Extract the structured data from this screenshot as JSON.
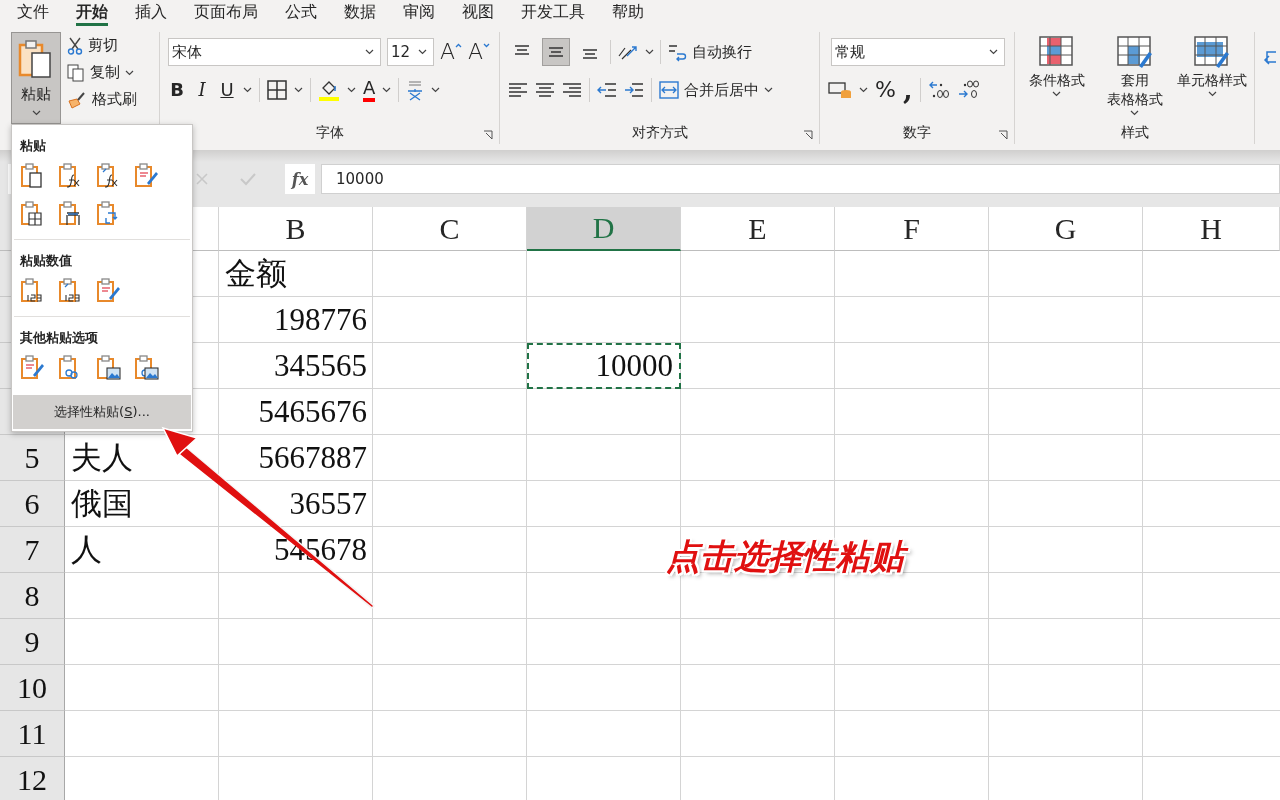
{
  "tabs": [
    {
      "label": "文件",
      "selected": false
    },
    {
      "label": "开始",
      "selected": true
    },
    {
      "label": "插入",
      "selected": false
    },
    {
      "label": "页面布局",
      "selected": false
    },
    {
      "label": "公式",
      "selected": false
    },
    {
      "label": "数据",
      "selected": false
    },
    {
      "label": "审阅",
      "selected": false
    },
    {
      "label": "视图",
      "selected": false
    },
    {
      "label": "开发工具",
      "selected": false
    },
    {
      "label": "帮助",
      "selected": false
    }
  ],
  "clipboard": {
    "paste": {
      "label": "粘贴",
      "pressed": true
    },
    "cut": "剪切",
    "copy": "复制",
    "format_painter": "格式刷"
  },
  "font": {
    "name": "宋体",
    "size": "12",
    "grow": "A",
    "shrink": "A",
    "bold": "B",
    "italic": "I",
    "underline": "U",
    "font_color": "A",
    "label": "字体"
  },
  "alignment": {
    "vertical": [
      {
        "selected": false
      },
      {
        "selected": true
      },
      {
        "selected": false
      }
    ],
    "wrap": "自动换行",
    "merge": "合并后居中",
    "label": "对齐方式"
  },
  "number": {
    "format": "常规",
    "percent": "%",
    "comma": ",",
    "label": "数字"
  },
  "styles": {
    "items": [
      {
        "lines": [
          "条件格式"
        ]
      },
      {
        "lines": [
          "套用",
          "表格格式"
        ]
      },
      {
        "lines": [
          "单元格样式"
        ]
      }
    ],
    "label": "样式"
  },
  "formula_bar": {
    "fx": "fx",
    "value": "10000"
  },
  "columns": [
    {
      "selected": false
    },
    {
      "label": "B",
      "selected": false
    },
    {
      "label": "C",
      "selected": false
    },
    {
      "label": "D",
      "selected": true
    },
    {
      "label": "E",
      "selected": false
    },
    {
      "label": "F",
      "selected": false
    },
    {
      "label": "G",
      "selected": false
    },
    {
      "label": "H",
      "selected": false
    }
  ],
  "rows": [
    {
      "column_2": {
        "text": "金额",
        "kind": "text",
        "copied": false
      }
    },
    {
      "column_2": {
        "text": "198776",
        "kind": "number",
        "copied": false
      }
    },
    {
      "column_2": {
        "text": "345565",
        "kind": "number",
        "copied": false
      },
      "column_4": {
        "text": "10000",
        "kind": "number",
        "copied": true
      }
    },
    {
      "column_2": {
        "text": "5465676",
        "kind": "number",
        "copied": false
      }
    },
    {
      "number": "5",
      "column_1": {
        "text": "夫人",
        "kind": "text",
        "copied": false
      },
      "column_2": {
        "text": "5667887",
        "kind": "number",
        "copied": false
      }
    },
    {
      "number": "6",
      "column_1": {
        "text": "俄国",
        "kind": "text",
        "copied": false
      },
      "column_2": {
        "text": "36557",
        "kind": "number",
        "copied": false
      }
    },
    {
      "number": "7",
      "column_1": {
        "text": "人",
        "kind": "text",
        "copied": false
      },
      "column_2": {
        "text": "545678",
        "kind": "number",
        "copied": false
      }
    },
    {
      "number": "8"
    },
    {
      "number": "9"
    },
    {
      "number": "10"
    },
    {
      "number": "11"
    },
    {
      "number": "12"
    }
  ],
  "paste_menu": {
    "sections": [
      {
        "title": "粘贴"
      },
      {
        "title": "粘贴数值"
      },
      {
        "title": "其他粘贴选项"
      }
    ],
    "footer": {
      "before": "选择性粘贴(",
      "key": "S",
      "after": ")..."
    }
  },
  "annotation": {
    "text": "点击选择性粘贴"
  }
}
